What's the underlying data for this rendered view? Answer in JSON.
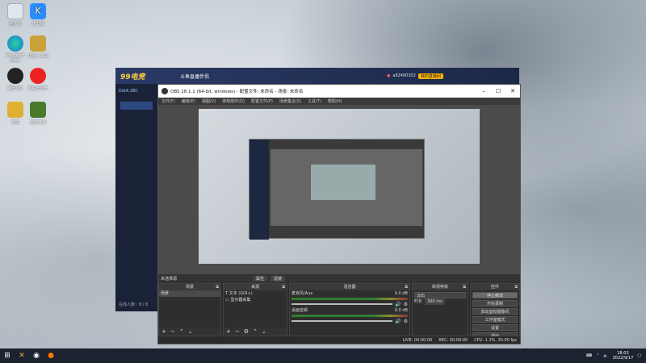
{
  "desktop": {
    "icons": [
      {
        "name": "recycle-bin-icon",
        "label": "回收站"
      },
      {
        "name": "kuaijian-icon",
        "label": "快剪辑"
      },
      {
        "name": "edge-icon",
        "label": "Microsoft Edge"
      },
      {
        "name": "app-icon-2",
        "label": "优化小工具"
      },
      {
        "name": "qq-icon",
        "label": "腾讯QQ"
      },
      {
        "name": "netease-music-icon",
        "label": "网易云音乐"
      },
      {
        "name": "wechat-icon",
        "label": "微信"
      },
      {
        "name": "app-icon-3",
        "label": "游戏工具"
      }
    ]
  },
  "douyu": {
    "logo": "99电竞",
    "title": "斗鱼直播伴侣",
    "user": "a82480302",
    "live_btn": "我的直播间",
    "side_text": "DotA 2BC",
    "status": "在线人数：8 / 8"
  },
  "obs": {
    "title": "OBS 28.1.1 (64-bit, windows) - 配置文件: 未命名 - 场景: 未命名",
    "menu": [
      "文件(F)",
      "编辑(E)",
      "视图(V)",
      "停靠部件(D)",
      "配置文件(P)",
      "场景集合(S)",
      "工具(T)",
      "帮助(H)"
    ],
    "no_source": "未选择源",
    "props_btn": "属性",
    "filter_btn": "滤镜",
    "panels": {
      "scenes": {
        "title": "场景",
        "items": [
          "场景"
        ]
      },
      "sources": {
        "title": "来源",
        "items": [
          "文本 (GDI+)",
          "显示器采集"
        ]
      },
      "mixer": {
        "title": "混音器",
        "tracks": [
          {
            "name": "麦克风/Aux",
            "db": "0.0 dB"
          },
          {
            "name": "桌面音频",
            "db": "0.0 dB"
          }
        ]
      },
      "transitions": {
        "title": "转场特效",
        "type": "淡出",
        "duration_label": "时长",
        "duration": "300 ms"
      },
      "controls": {
        "title": "控件",
        "buttons": [
          "停止推流",
          "开始录制",
          "启动虚拟摄像机",
          "工作室模式",
          "设置",
          "退出"
        ]
      }
    },
    "status": {
      "live": "LIVE: 00:00:00",
      "rec": "REC: 00:00:00",
      "cpu": "CPU: 1.3%, 30.00 fps"
    }
  },
  "taskbar": {
    "time": "18:03",
    "date": "2022/9/17"
  }
}
